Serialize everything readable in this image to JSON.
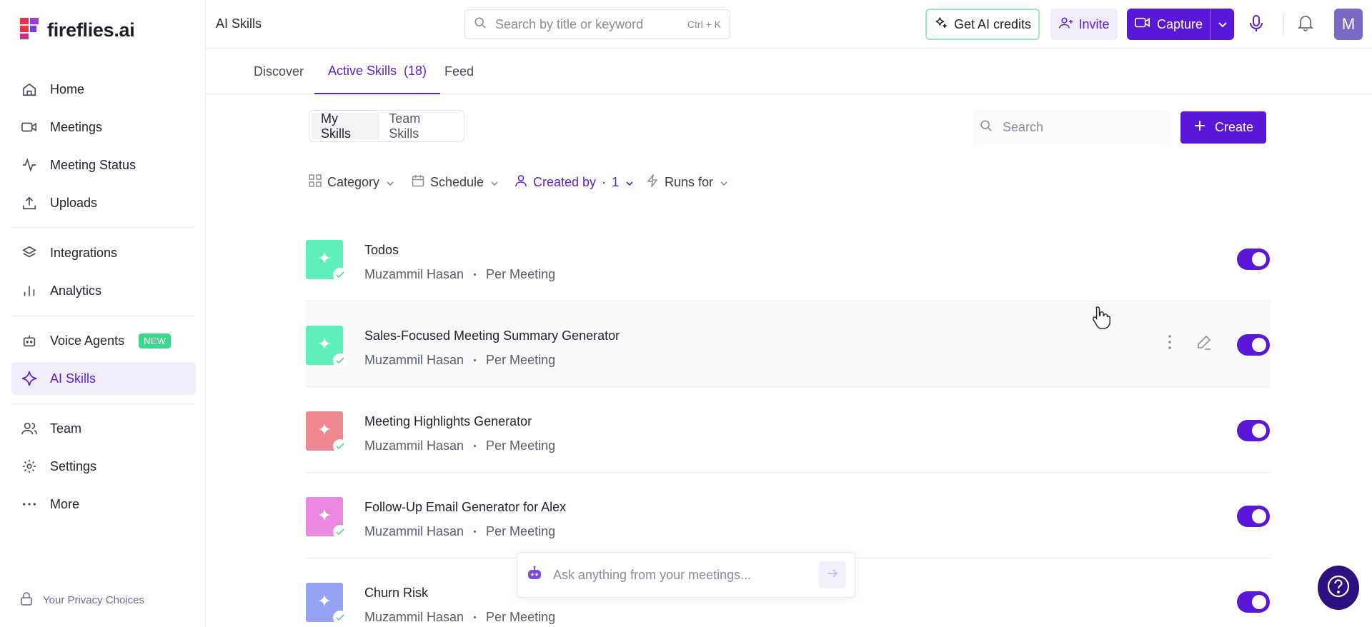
{
  "app": {
    "logo_text": "fireflies.ai"
  },
  "sidebar": {
    "items": [
      {
        "label": "Home",
        "icon": "home-icon"
      },
      {
        "label": "Meetings",
        "icon": "video-icon"
      },
      {
        "label": "Meeting Status",
        "icon": "activity-icon"
      },
      {
        "label": "Uploads",
        "icon": "upload-icon"
      },
      {
        "label": "Integrations",
        "icon": "layers-icon"
      },
      {
        "label": "Analytics",
        "icon": "bar-chart-icon"
      },
      {
        "label": "Voice Agents",
        "icon": "robot-icon",
        "badge": "NEW"
      },
      {
        "label": "AI Skills",
        "icon": "sparkle-icon",
        "active": true
      },
      {
        "label": "Team",
        "icon": "users-icon"
      },
      {
        "label": "Settings",
        "icon": "gear-icon"
      },
      {
        "label": "More",
        "icon": "dots-icon"
      }
    ],
    "privacy": "Your Privacy Choices"
  },
  "header": {
    "title": "AI Skills",
    "search_placeholder": "Search by title or keyword",
    "search_shortcut": "Ctrl + K",
    "credits_label": "Get AI credits",
    "invite_label": "Invite",
    "capture_label": "Capture",
    "avatar_initial": "M"
  },
  "tabs": {
    "discover": "Discover",
    "active": "Active Skills",
    "active_count": "(18)",
    "feed": "Feed"
  },
  "segment": {
    "my": "My Skills",
    "team": "Team Skills"
  },
  "toolbar": {
    "search_placeholder": "Search",
    "create_label": "Create"
  },
  "filters": {
    "category": "Category",
    "schedule": "Schedule",
    "created_by": "Created by",
    "created_by_count": "1",
    "runs_for": "Runs for"
  },
  "skills": [
    {
      "name": "Todos",
      "author": "Muzammil Hasan",
      "frequency": "Per Meeting",
      "color": "#5ef0b8",
      "enabled": true
    },
    {
      "name": "Sales-Focused Meeting Summary Generator",
      "author": "Muzammil Hasan",
      "frequency": "Per Meeting",
      "color": "#5ef0b8",
      "enabled": true
    },
    {
      "name": "Meeting Highlights Generator",
      "author": "Muzammil Hasan",
      "frequency": "Per Meeting",
      "color": "#ef8790",
      "enabled": true
    },
    {
      "name": "Follow-Up Email Generator for Alex",
      "author": "Muzammil Hasan",
      "frequency": "Per Meeting",
      "color": "#ea88df",
      "enabled": true
    },
    {
      "name": "Churn Risk",
      "author": "Muzammil Hasan",
      "frequency": "Per Meeting",
      "color": "#95a3f2",
      "enabled": true
    }
  ],
  "assistant": {
    "placeholder": "Ask anything from your meetings..."
  }
}
